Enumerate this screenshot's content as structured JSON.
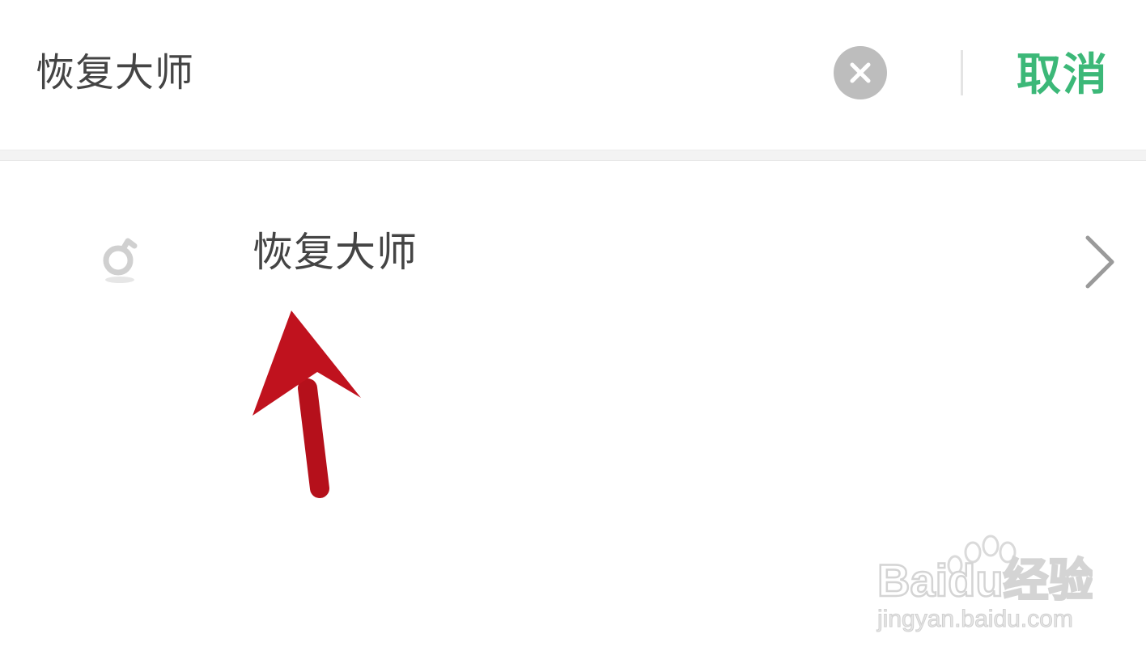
{
  "search": {
    "query": "恢复大师",
    "cancel_label": "取消"
  },
  "result": {
    "label": "恢复大师",
    "icon": "mini-program-icon"
  },
  "watermark": {
    "brand": "Baidu经验",
    "url": "jingyan.baidu.com"
  },
  "colors": {
    "accent": "#3cb878",
    "text": "#444444",
    "clear_button": "#bdbdbd",
    "arrow": "#b5101b"
  }
}
